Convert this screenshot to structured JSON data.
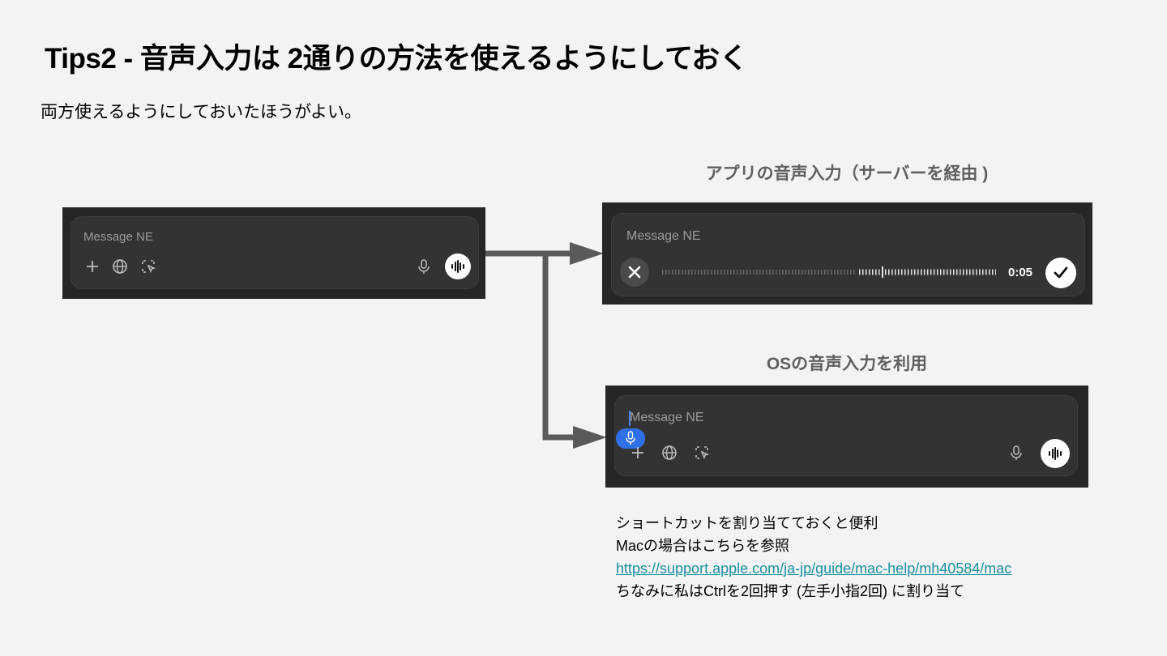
{
  "slide": {
    "title": "Tips2 - 音声入力は 2通りの方法を使えるようにしておく",
    "subtitle": "両方使えるようにしておいたほうがよい。"
  },
  "panels": {
    "app_label": "アプリの音声入力（サーバーを経由 )",
    "os_label": "OSの音声入力を利用",
    "placeholder": "Message NE",
    "timer": "0:05"
  },
  "notes": {
    "line1": "ショートカットを割り当てておくと便利",
    "line2": "Macの場合はこちらを参照",
    "link": "https://support.apple.com/ja-jp/guide/mac-help/mh40584/mac",
    "line4": "ちなみに私はCtrlを2回押す (左手小指2回) に割り当て"
  },
  "icons": {
    "plus": "plus-icon",
    "globe": "globe-icon",
    "cursor_select": "cursor-select-icon",
    "mic": "microphone-icon",
    "voice_mode": "voice-waveform-icon",
    "cancel": "close-icon",
    "confirm": "checkmark-icon"
  },
  "colors": {
    "background": "#f3f3f3",
    "screenshot_bg": "#262626",
    "arrow": "#5a5a5a",
    "link": "#1a8fa0",
    "dictation_badge": "#2f6fe8"
  }
}
